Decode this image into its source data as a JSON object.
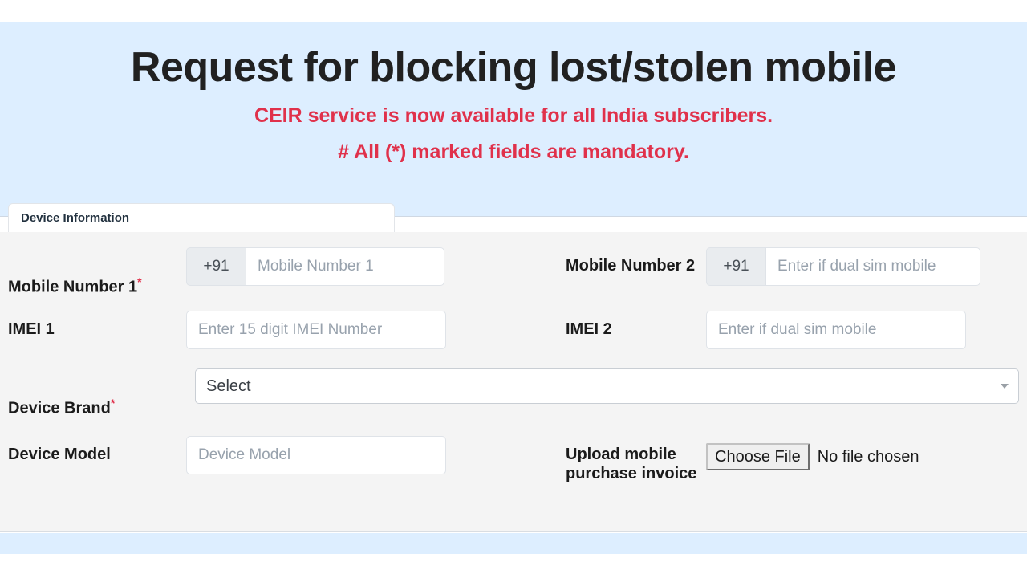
{
  "header": {
    "title": "Request for blocking lost/stolen mobile",
    "notice": "CEIR service is now available for all India subscribers.",
    "mandatory_note": "# All (*) marked fields are mandatory.",
    "title_color": "#212121",
    "notice_color": "#e0314b",
    "band_color": "#ddeeff"
  },
  "tabs": [
    {
      "label": "Device Information",
      "active": true
    }
  ],
  "form": {
    "section": "Device Information",
    "fields": {
      "mobile_number_1": {
        "label": "Mobile Number 1",
        "required": true,
        "required_mark": "*",
        "prefix": "+91",
        "placeholder": "Mobile Number 1",
        "value": ""
      },
      "mobile_number_2": {
        "label": "Mobile Number 2",
        "required": false,
        "prefix": "+91",
        "placeholder": "Enter if dual sim mobile",
        "value": ""
      },
      "imei_1": {
        "label": "IMEI 1",
        "required": false,
        "placeholder": "Enter 15 digit IMEI Number",
        "value": ""
      },
      "imei_2": {
        "label": "IMEI 2",
        "required": false,
        "placeholder": "Enter if dual sim mobile",
        "value": ""
      },
      "device_brand": {
        "label": "Device Brand",
        "required": true,
        "required_mark": "*",
        "selected": "Select",
        "options": [
          "Select"
        ]
      },
      "device_model": {
        "label": "Device Model",
        "required": false,
        "placeholder": "Device Model",
        "value": ""
      },
      "upload_invoice": {
        "label": "Upload mobile\npurchase invoice",
        "required": false,
        "button_label": "Choose File",
        "status": "No file chosen"
      }
    }
  }
}
